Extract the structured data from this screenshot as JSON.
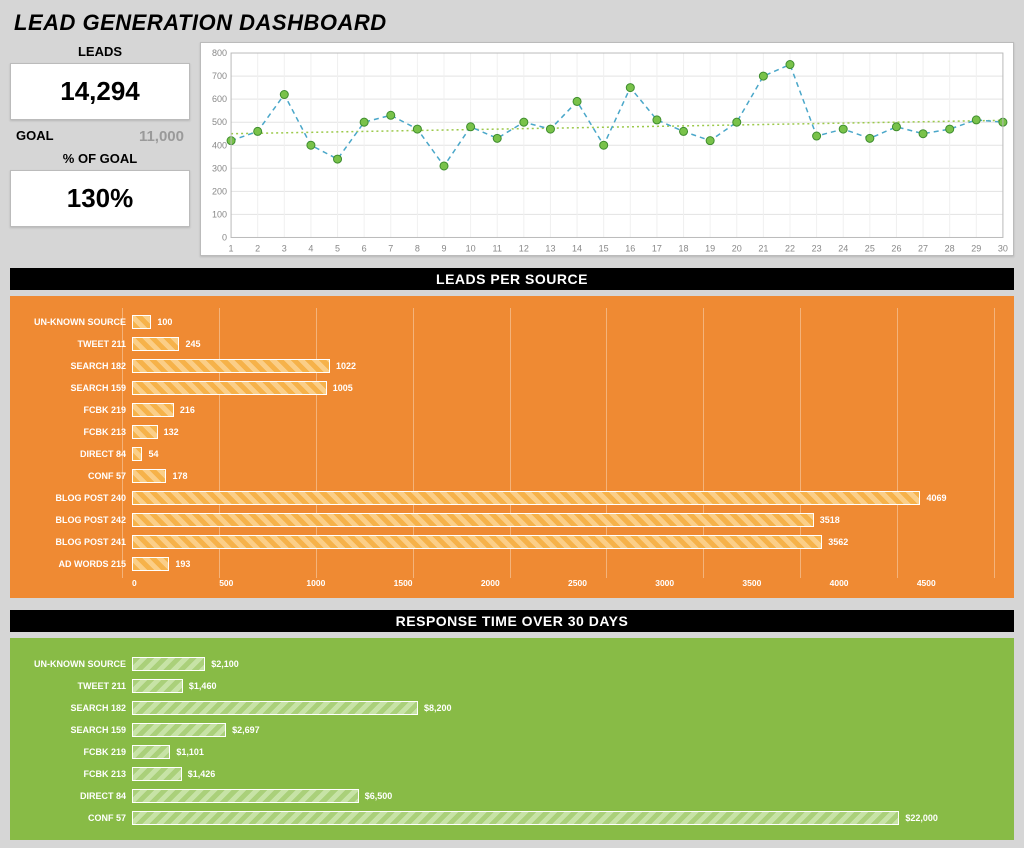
{
  "title": "LEAD GENERATION DASHBOARD",
  "kpi": {
    "leads_label": "LEADS",
    "leads_value": "14,294",
    "goal_label": "GOAL",
    "goal_value": "11,000",
    "pct_goal_label": "% OF GOAL",
    "pct_goal_value": "130%"
  },
  "sections": {
    "leads_per_source": "LEADS PER SOURCE",
    "response_time": "RESPONSE TIME OVER 30 DAYS"
  },
  "chart_data": [
    {
      "id": "daily_leads",
      "type": "line",
      "title": "",
      "xlabel": "",
      "ylabel": "",
      "xlim": [
        1,
        30
      ],
      "ylim": [
        0,
        800
      ],
      "x": [
        1,
        2,
        3,
        4,
        5,
        6,
        7,
        8,
        9,
        10,
        11,
        12,
        13,
        14,
        15,
        16,
        17,
        18,
        19,
        20,
        21,
        22,
        23,
        24,
        25,
        26,
        27,
        28,
        29,
        30
      ],
      "values": [
        420,
        460,
        620,
        400,
        340,
        500,
        530,
        470,
        310,
        480,
        430,
        500,
        470,
        590,
        400,
        650,
        510,
        460,
        420,
        500,
        700,
        750,
        440,
        470,
        430,
        480,
        450,
        470,
        510,
        500
      ],
      "trend": [
        450,
        452,
        454,
        456,
        458,
        460,
        462,
        464,
        466,
        468,
        470,
        472,
        474,
        476,
        478,
        480,
        482,
        484,
        486,
        488,
        490,
        492,
        494,
        496,
        498,
        500,
        502,
        504,
        506,
        508
      ],
      "y_ticks": [
        0,
        100,
        200,
        300,
        400,
        500,
        600,
        700,
        800
      ]
    },
    {
      "id": "leads_per_source",
      "type": "bar",
      "orientation": "horizontal",
      "xlim": [
        0,
        4500
      ],
      "x_ticks": [
        0,
        500,
        1000,
        1500,
        2000,
        2500,
        3000,
        3500,
        4000,
        4500
      ],
      "categories": [
        "UN-KNOWN SOURCE",
        "TWEET 211",
        "SEARCH 182",
        "SEARCH 159",
        "FCBK 219",
        "FCBK 213",
        "DIRECT 84",
        "CONF 57",
        "BLOG POST 240",
        "BLOG POST 242",
        "BLOG POST 241",
        "AD WORDS 215"
      ],
      "values": [
        100,
        245,
        1022,
        1005,
        216,
        132,
        54,
        178,
        4069,
        3518,
        3562,
        193
      ],
      "value_labels": [
        "100",
        "245",
        "1022",
        "1005",
        "216",
        "132",
        "54",
        "178",
        "4069",
        "3518",
        "3562",
        "193"
      ]
    },
    {
      "id": "response_time",
      "type": "bar",
      "orientation": "horizontal",
      "xlim": [
        0,
        25000
      ],
      "categories": [
        "UN-KNOWN SOURCE",
        "TWEET 211",
        "SEARCH 182",
        "SEARCH 159",
        "FCBK 219",
        "FCBK 213",
        "DIRECT 84",
        "CONF 57"
      ],
      "values": [
        2100,
        1460,
        8200,
        2697,
        1101,
        1426,
        6500,
        22000
      ],
      "value_labels": [
        "$2,100",
        "$1,460",
        "$8,200",
        "$2,697",
        "$1,101",
        "$1,426",
        "$6,500",
        "$22,000"
      ]
    }
  ]
}
